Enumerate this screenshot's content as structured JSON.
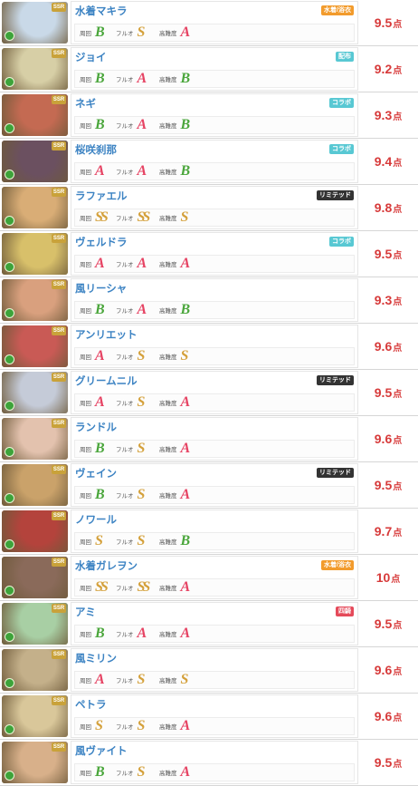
{
  "labels": {
    "shuukai": "周回",
    "fullauto": "フルオ",
    "difficult": "高難度",
    "ssr": "SSR"
  },
  "characters": [
    {
      "name": "水着マキラ",
      "tag": "水着/浴衣",
      "tag_color": "orange",
      "g1": "B",
      "g2": "S",
      "g3": "A",
      "score": "9.5",
      "unit": "点",
      "art": "#c9d9e8"
    },
    {
      "name": "ジョイ",
      "tag": "配布",
      "tag_color": "teal",
      "g1": "B",
      "g2": "A",
      "g3": "B",
      "score": "9.2",
      "unit": "点",
      "art": "#d7cfa6"
    },
    {
      "name": "ネギ",
      "tag": "コラボ",
      "tag_color": "teal",
      "g1": "B",
      "g2": "A",
      "g3": "B",
      "score": "9.3",
      "unit": "点",
      "art": "#c46a52"
    },
    {
      "name": "桜咲刹那",
      "tag": "コラボ",
      "tag_color": "teal",
      "g1": "A",
      "g2": "A",
      "g3": "B",
      "score": "9.4",
      "unit": "点",
      "art": "#6b5060"
    },
    {
      "name": "ラファエル",
      "tag": "リミテッド",
      "tag_color": "dark",
      "g1": "SS",
      "g2": "SS",
      "g3": "S",
      "score": "9.8",
      "unit": "点",
      "art": "#d9ad76"
    },
    {
      "name": "ヴェルドラ",
      "tag": "コラボ",
      "tag_color": "teal",
      "g1": "A",
      "g2": "A",
      "g3": "A",
      "score": "9.5",
      "unit": "点",
      "art": "#d8c06a"
    },
    {
      "name": "風リーシャ",
      "tag": "",
      "tag_color": "",
      "g1": "B",
      "g2": "A",
      "g3": "B",
      "score": "9.3",
      "unit": "点",
      "art": "#d9a07e"
    },
    {
      "name": "アンリエット",
      "tag": "",
      "tag_color": "",
      "g1": "A",
      "g2": "S",
      "g3": "S",
      "score": "9.6",
      "unit": "点",
      "art": "#c95a55"
    },
    {
      "name": "グリームニル",
      "tag": "リミテッド",
      "tag_color": "dark",
      "g1": "A",
      "g2": "S",
      "g3": "A",
      "score": "9.5",
      "unit": "点",
      "art": "#c5cbd8"
    },
    {
      "name": "ランドル",
      "tag": "",
      "tag_color": "",
      "g1": "B",
      "g2": "S",
      "g3": "A",
      "score": "9.6",
      "unit": "点",
      "art": "#e3c2ae"
    },
    {
      "name": "ヴェイン",
      "tag": "リミテッド",
      "tag_color": "dark",
      "g1": "B",
      "g2": "S",
      "g3": "A",
      "score": "9.5",
      "unit": "点",
      "art": "#caa26a"
    },
    {
      "name": "ノワール",
      "tag": "",
      "tag_color": "",
      "g1": "S",
      "g2": "S",
      "g3": "B",
      "score": "9.7",
      "unit": "点",
      "art": "#b4433c"
    },
    {
      "name": "水着ガレヲン",
      "tag": "水着/浴衣",
      "tag_color": "orange",
      "g1": "SS",
      "g2": "SS",
      "g3": "A",
      "score": "10",
      "unit": "点",
      "art": "#8a6a5a"
    },
    {
      "name": "アミ",
      "tag": "四騎",
      "tag_color": "red",
      "g1": "B",
      "g2": "A",
      "g3": "A",
      "score": "9.5",
      "unit": "点",
      "art": "#a8cfa4"
    },
    {
      "name": "風ミリン",
      "tag": "",
      "tag_color": "",
      "g1": "A",
      "g2": "S",
      "g3": "S",
      "score": "9.6",
      "unit": "点",
      "art": "#c4b08a"
    },
    {
      "name": "ペトラ",
      "tag": "",
      "tag_color": "",
      "g1": "S",
      "g2": "S",
      "g3": "A",
      "score": "9.6",
      "unit": "点",
      "art": "#d9c79a"
    },
    {
      "name": "風ヴァイト",
      "tag": "",
      "tag_color": "",
      "g1": "B",
      "g2": "S",
      "g3": "A",
      "score": "9.5",
      "unit": "点",
      "art": "#d8b08a"
    }
  ]
}
